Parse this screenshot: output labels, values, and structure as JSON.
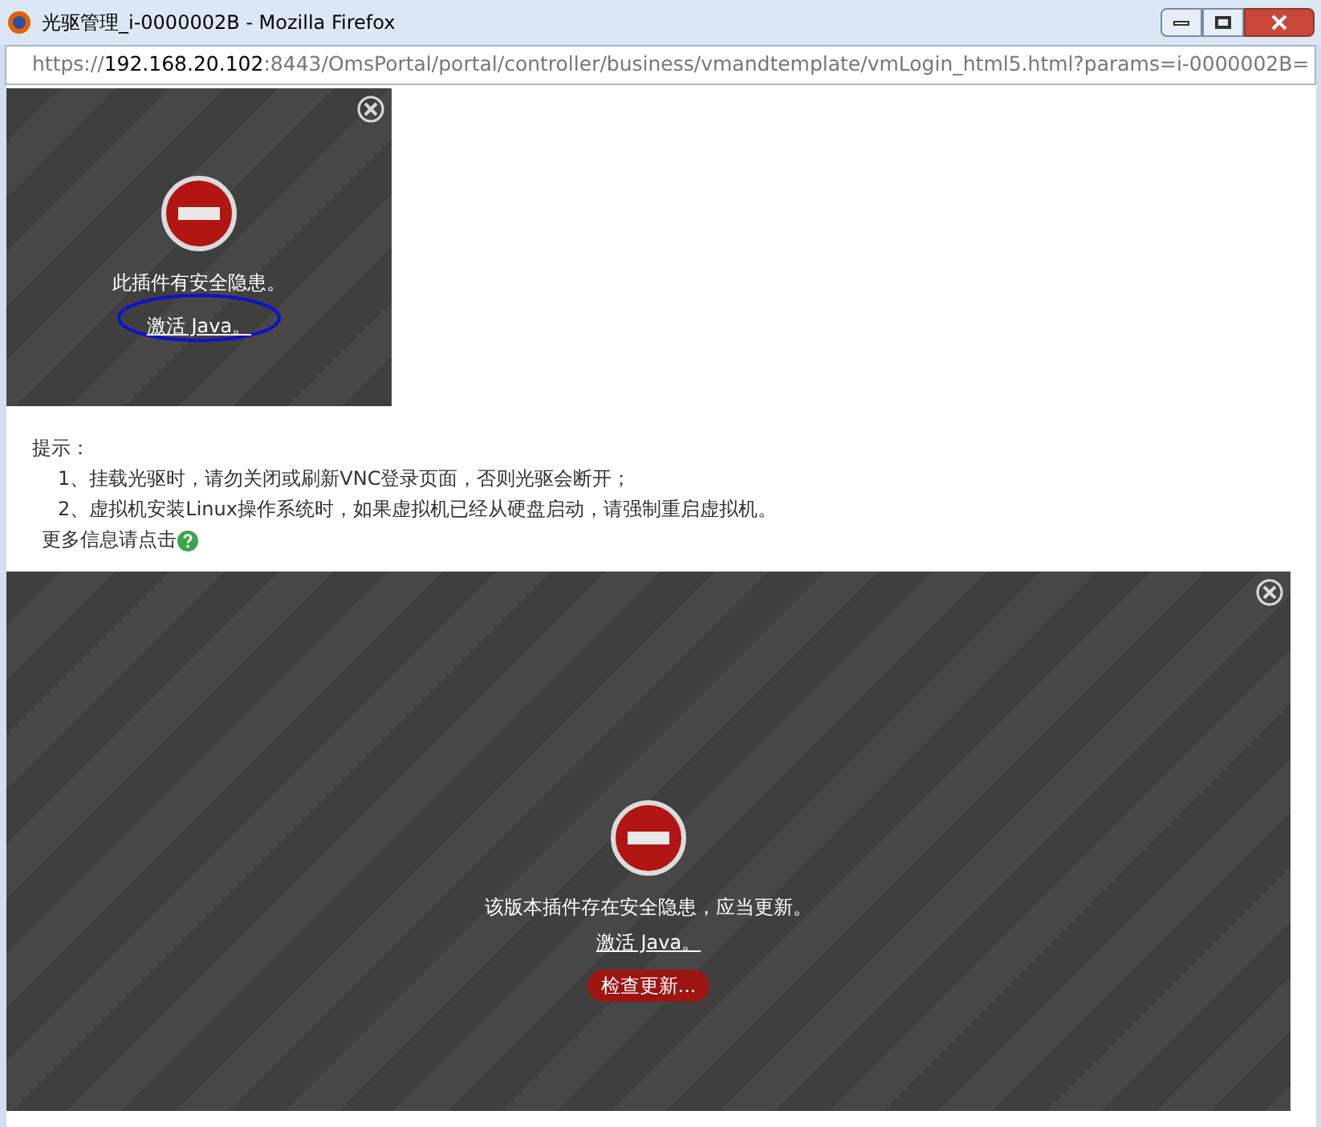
{
  "window": {
    "title": "光驱管理_i-0000002B - Mozilla Firefox"
  },
  "address_bar": {
    "scheme": "https://",
    "host": "192.168.20.102",
    "rest": ":8443/OmsPortal/portal/controller/business/vmandtemplate/vmLogin_html5.html?params=i-0000002B="
  },
  "plugins": [
    {
      "kind": "small",
      "message": "此插件有安全隐患。",
      "link": "激活 Java。",
      "annotated": true
    },
    {
      "kind": "large",
      "message": "该版本插件存在安全隐患，应当更新。",
      "link": "激活 Java。",
      "button": "检查更新..."
    }
  ],
  "hints": {
    "title": "提示：",
    "items": [
      "1、挂载光驱时，请勿关闭或刷新VNC登录页面，否则光驱会断开；",
      "2、虚拟机安装Linux操作系统时，如果虚拟机已经从硬盘启动，请强制重启虚拟机。"
    ],
    "more": "更多信息请点击"
  }
}
